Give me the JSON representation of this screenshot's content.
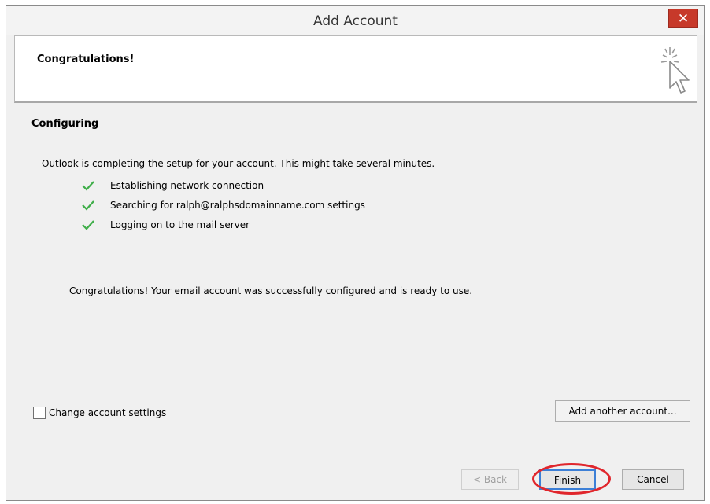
{
  "window": {
    "title": "Add Account",
    "close_label": "✕"
  },
  "header": {
    "title": "Congratulations!",
    "icon": "cursor-sparkle-icon"
  },
  "section": {
    "heading": "Configuring"
  },
  "progress": {
    "intro": "Outlook is completing the setup for your account. This might take several minutes.",
    "steps": [
      {
        "label": "Establishing network connection",
        "status": "done"
      },
      {
        "label": "Searching for ralph@ralphsdomainname.com settings",
        "status": "done"
      },
      {
        "label": "Logging on to the mail server",
        "status": "done"
      }
    ],
    "check_color": "#3fae49"
  },
  "result_message": "Congratulations! Your email account was successfully configured and is ready to use.",
  "options": {
    "change_settings_label": "Change account settings",
    "change_settings_checked": false,
    "add_another_label": "Add another account..."
  },
  "footer": {
    "back_label": "< Back",
    "finish_label": "Finish",
    "cancel_label": "Cancel"
  },
  "colors": {
    "close_button": "#c7392a",
    "highlight_ring": "#e0262c",
    "default_button_border": "#3c7fd6"
  }
}
